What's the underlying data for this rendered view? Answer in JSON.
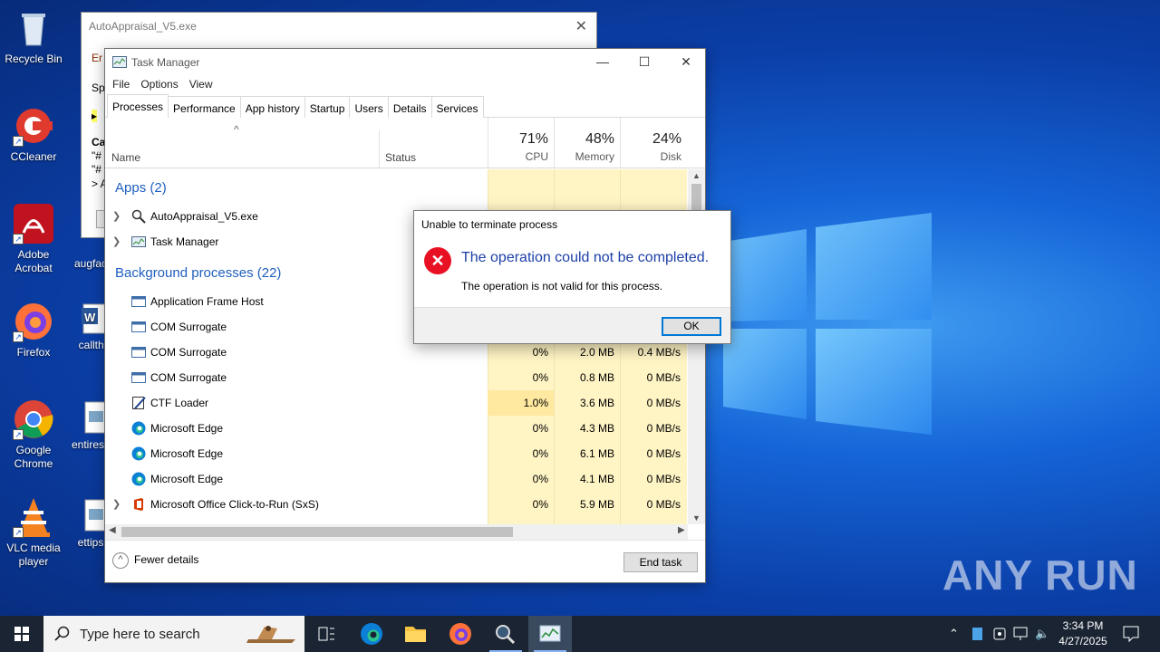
{
  "desktop_icons": [
    {
      "label": "Recycle Bin",
      "icon": "recycle-bin-icon"
    },
    {
      "label": "CCleaner",
      "icon": "ccleaner-icon"
    },
    {
      "label": "Adobe Acrobat",
      "icon": "acrobat-icon"
    },
    {
      "label": "Firefox",
      "icon": "firefox-icon"
    },
    {
      "label": "Google Chrome",
      "icon": "chrome-icon"
    },
    {
      "label": "VLC media player",
      "icon": "vlc-icon"
    },
    {
      "label": "augfac",
      "icon": "file-icon"
    },
    {
      "label": "callthi",
      "icon": "word-doc-icon"
    },
    {
      "label": "entiresc",
      "icon": "image-file-icon"
    },
    {
      "label": "ettips",
      "icon": "image-file-icon"
    }
  ],
  "background_window": {
    "title": "AutoAppraisal_V5.exe",
    "fragments": [
      "Er",
      "Sp",
      "▸",
      "Ca",
      "\"#",
      "\"#",
      "> A"
    ]
  },
  "task_manager": {
    "title": "Task Manager",
    "menu": [
      "File",
      "Options",
      "View"
    ],
    "tabs": [
      "Processes",
      "Performance",
      "App history",
      "Startup",
      "Users",
      "Details",
      "Services"
    ],
    "active_tab": "Processes",
    "columns": {
      "name": "Name",
      "status": "Status",
      "cpu": {
        "pct": "71%",
        "label": "CPU"
      },
      "memory": {
        "pct": "48%",
        "label": "Memory"
      },
      "disk": {
        "pct": "24%",
        "label": "Disk"
      }
    },
    "groups": {
      "apps": "Apps (2)",
      "background": "Background processes (22)"
    },
    "apps": [
      {
        "name": "AutoAppraisal_V5.exe",
        "icon": "magnifier-icon"
      },
      {
        "name": "Task Manager",
        "icon": "task-manager-icon"
      }
    ],
    "background": [
      {
        "name": "Application Frame Host",
        "cpu": "",
        "memory": "",
        "disk": ""
      },
      {
        "name": "COM Surrogate",
        "cpu": "",
        "memory": "",
        "disk": ""
      },
      {
        "name": "COM Surrogate",
        "cpu": "0%",
        "memory": "2.0 MB",
        "disk": "0.4 MB/s"
      },
      {
        "name": "COM Surrogate",
        "cpu": "0%",
        "memory": "0.8 MB",
        "disk": "0 MB/s"
      },
      {
        "name": "CTF Loader",
        "cpu": "1.0%",
        "memory": "3.6 MB",
        "disk": "0 MB/s"
      },
      {
        "name": "Microsoft Edge",
        "cpu": "0%",
        "memory": "4.3 MB",
        "disk": "0 MB/s"
      },
      {
        "name": "Microsoft Edge",
        "cpu": "0%",
        "memory": "6.1 MB",
        "disk": "0 MB/s"
      },
      {
        "name": "Microsoft Edge",
        "cpu": "0%",
        "memory": "4.1 MB",
        "disk": "0 MB/s"
      },
      {
        "name": "Microsoft Office Click-to-Run (SxS)",
        "cpu": "0%",
        "memory": "5.9 MB",
        "disk": "0 MB/s"
      }
    ],
    "fewer_details": "Fewer details",
    "end_task": "End task"
  },
  "dialog": {
    "title": "Unable to terminate process",
    "main": "The operation could not be completed.",
    "sub": "The operation is not valid for this process.",
    "ok": "OK"
  },
  "watermark": "ANY RUN",
  "taskbar": {
    "search_placeholder": "Type here to search",
    "time": "3:34 PM",
    "date": "4/27/2025"
  }
}
